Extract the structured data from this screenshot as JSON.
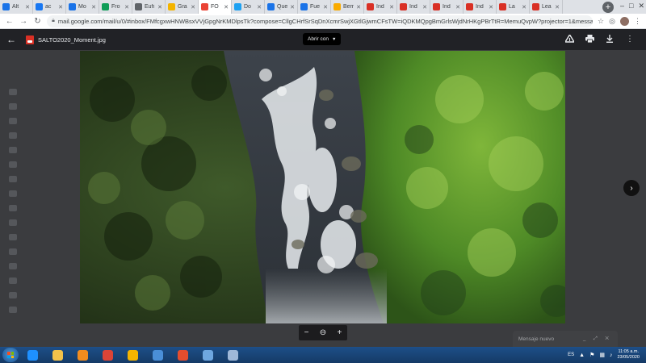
{
  "browser": {
    "tabs": [
      {
        "title": "Alt",
        "color": "#1a73e8",
        "active": false
      },
      {
        "title": "ac",
        "color": "#1877f2",
        "active": false
      },
      {
        "title": "Mo",
        "color": "#1a73e8",
        "active": false
      },
      {
        "title": "Fro",
        "color": "#0f9d58",
        "active": false
      },
      {
        "title": "Eufi",
        "color": "#5f6368",
        "active": false
      },
      {
        "title": "Gra",
        "color": "#f4b400",
        "active": false
      },
      {
        "title": "FO",
        "color": "#ea4335",
        "active": true
      },
      {
        "title": "Do",
        "color": "#1da1f2",
        "active": false
      },
      {
        "title": "Que",
        "color": "#1a73e8",
        "active": false
      },
      {
        "title": "Fue",
        "color": "#1a73e8",
        "active": false
      },
      {
        "title": "Bemo",
        "color": "#f9ab00",
        "active": false
      },
      {
        "title": "Ind",
        "color": "#d93025",
        "active": false
      },
      {
        "title": "Ind",
        "color": "#d93025",
        "active": false
      },
      {
        "title": "Ind",
        "color": "#d93025",
        "active": false
      },
      {
        "title": "Ind",
        "color": "#d93025",
        "active": false
      },
      {
        "title": "La",
        "color": "#d93025",
        "active": false
      },
      {
        "title": "Lea",
        "color": "#d93025",
        "active": false
      }
    ],
    "new_tab": "+",
    "url": "mail.google.com/mail/u/0/#inbox/FMfcgxwHNWBsxVVjGpgNrKMDlpsTk?compose=CllgCHrfSrSqDnXcmrSwjXGtlGjwmCFsTW=iQDKMQpgBmGrlsWjdNrHKgPBrTtR=MemuQvpW?projector=1&messagePartId"
  },
  "viewer": {
    "file_name": "SALTO2020_Moment.jpg",
    "open_with_label": "Abrir con",
    "zoom_out": "−",
    "zoom_fit": "⊖",
    "zoom_in": "+",
    "next": "›"
  },
  "compose": {
    "title": "Mensaje nuevo"
  },
  "taskbar": {
    "apps": [
      {
        "name": "ie",
        "color": "#1e90ff"
      },
      {
        "name": "explorer",
        "color": "#f3c24a"
      },
      {
        "name": "media",
        "color": "#f28c1e"
      },
      {
        "name": "chrome",
        "color": "#db4437"
      },
      {
        "name": "audio",
        "color": "#f4b400"
      },
      {
        "name": "word",
        "color": "#4a8fd8"
      },
      {
        "name": "anydesk",
        "color": "#e44d2e"
      },
      {
        "name": "screen",
        "color": "#6ea7e0"
      },
      {
        "name": "network",
        "color": "#9fb8d8"
      }
    ],
    "language": "ES",
    "time": "11:05 a.m.",
    "date": "23/05/2020"
  }
}
